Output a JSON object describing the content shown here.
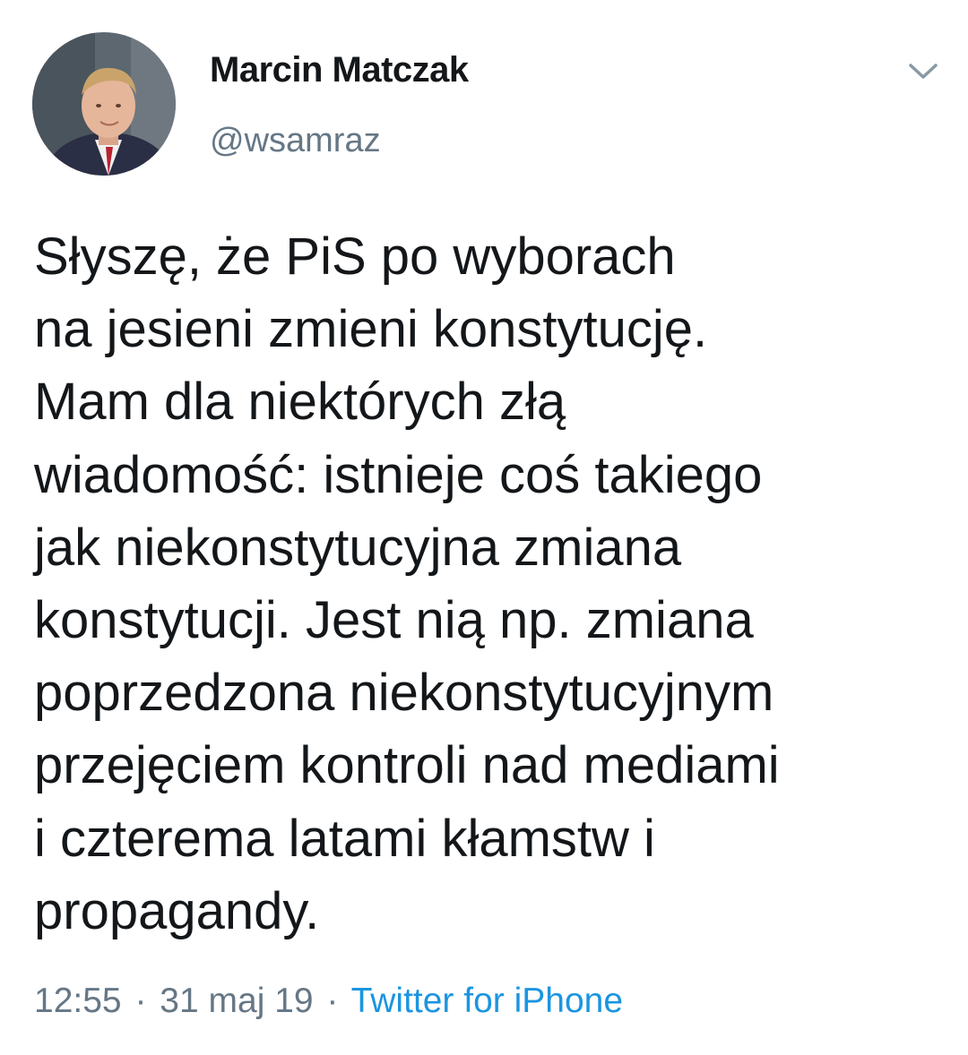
{
  "author": {
    "name": "Marcin Matczak",
    "handle": "@wsamraz",
    "avatar_icon": "profile-photo-avatar"
  },
  "menu_icon": "chevron-down-icon",
  "tweet": {
    "lines": [
      "Słyszę, że PiS po wyborach",
      "na jesieni zmieni konstytucję.",
      "Mam dla niektórych złą",
      "wiadomość: istnieje coś takiego",
      "jak niekonstytucyjna zmiana",
      "konstytucji. Jest nią np. zmiana",
      "poprzedzona niekonstytucyjnym",
      "przejęciem kontroli nad mediami",
      "i czterema latami kłamstw i",
      "propagandy."
    ]
  },
  "meta": {
    "time": "12:55",
    "separator": "·",
    "date": "31 maj 19",
    "source": "Twitter for iPhone"
  },
  "colors": {
    "text": "#14171a",
    "secondary": "#657786",
    "link": "#1b95e0"
  }
}
